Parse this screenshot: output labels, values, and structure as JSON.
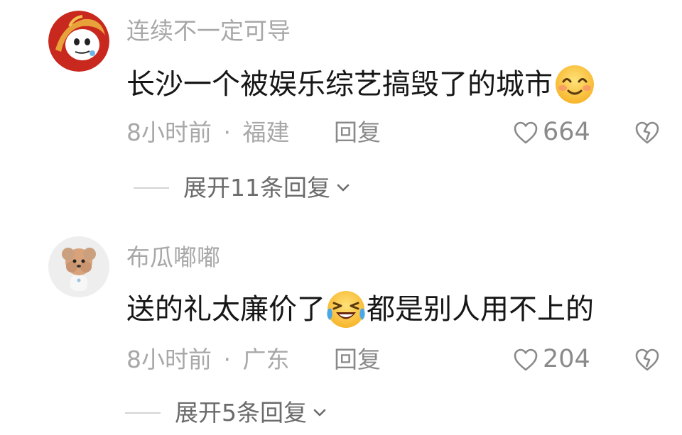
{
  "comments": [
    {
      "username": "连续不一定可导",
      "text_before": "长沙一个被娱乐综艺搞毁了的城市",
      "text_after": "",
      "emoji": "smiling-face-icon",
      "time": "8小时前",
      "location": "福建",
      "meta_sep": "·",
      "reply_label": "回复",
      "likes": "664",
      "expand_label": "展开11条回复"
    },
    {
      "username": "布瓜嘟嘟",
      "text_before": "送的礼太廉价了",
      "text_after": "都是别人用不上的",
      "emoji": "laughing-crying-face-icon",
      "time": "8小时前",
      "location": "广东",
      "meta_sep": "·",
      "reply_label": "回复",
      "likes": "204",
      "expand_label": "展开5条回复"
    }
  ],
  "colors": {
    "text": "#161616",
    "muted": "#a8a8a8",
    "action": "#8a8a8a"
  }
}
